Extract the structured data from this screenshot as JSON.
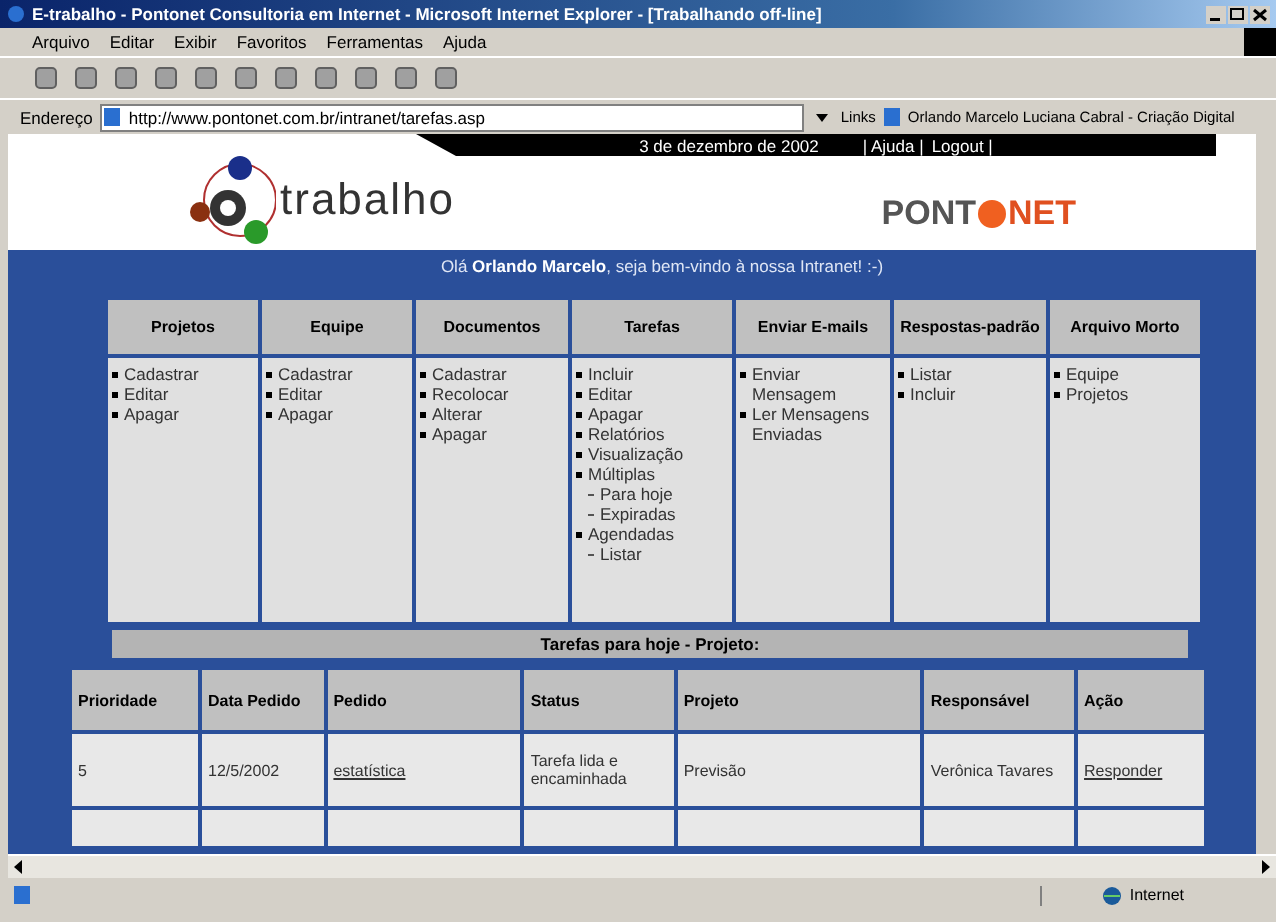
{
  "window": {
    "title": "E-trabalho - Pontonet Consultoria em Internet - Microsoft Internet Explorer - [Trabalhando off-line]"
  },
  "menu_bar": [
    "Arquivo",
    "Editar",
    "Exibir",
    "Favoritos",
    "Ferramentas",
    "Ajuda"
  ],
  "address_bar": {
    "label": "Endereço",
    "value": "http://www.pontonet.com.br/intranet/tarefas.asp",
    "links_label": "Links",
    "link": "Orlando Marcelo Luciana Cabral - Criação Digital"
  },
  "header": {
    "date": "3 de dezembro de 2002",
    "links": [
      "| Ajuda |",
      "Logout |"
    ],
    "logo": "trabalho",
    "partner_logo_left": "PONT",
    "partner_logo_right": "NET",
    "greeting": "Olá **Orlando Marcelo**, seja bem-vindo à nossa Intranet! :-)"
  },
  "menu_columns": [
    {
      "title": "Projetos",
      "items": [
        {
          "label": "Cadastrar"
        },
        {
          "label": "Editar"
        },
        {
          "label": "Apagar"
        }
      ]
    },
    {
      "title": "Equipe",
      "items": [
        {
          "label": "Cadastrar"
        },
        {
          "label": "Editar"
        },
        {
          "label": "Apagar"
        }
      ]
    },
    {
      "title": "Documentos",
      "items": [
        {
          "label": "Cadastrar"
        },
        {
          "label": "Recolocar"
        },
        {
          "label": "Alterar"
        },
        {
          "label": "Apagar"
        }
      ]
    },
    {
      "title": "Tarefas",
      "items": [
        {
          "label": "Incluir"
        },
        {
          "label": "Editar"
        },
        {
          "label": "Apagar"
        },
        {
          "label": "Relatórios"
        },
        {
          "label": "Visualização"
        },
        {
          "label": "Múltiplas",
          "children": [
            {
              "label": "Para hoje"
            },
            {
              "label": "Expiradas"
            }
          ]
        },
        {
          "label": "Agendadas",
          "children": [
            {
              "label": "Listar"
            }
          ]
        }
      ]
    },
    {
      "title": "Enviar E-mails",
      "items": [
        {
          "label": "Enviar Mensagem"
        },
        {
          "label": "Ler Mensagens Enviadas"
        }
      ]
    },
    {
      "title": "Respostas-padrão",
      "items": [
        {
          "label": "Listar"
        },
        {
          "label": "Incluir"
        }
      ]
    },
    {
      "title": "Arquivo Morto",
      "items": [
        {
          "label": "Equipe"
        },
        {
          "label": "Projetos"
        }
      ]
    }
  ],
  "tasks": {
    "title": "Tarefas para hoje - Projeto:",
    "columns": [
      "Prioridade",
      "Data Pedido",
      "Pedido",
      "Status",
      "Projeto",
      "Responsável",
      "Ação"
    ],
    "rows": [
      [
        "5",
        "12/5/2002",
        "estatística",
        "Tarefa lida e encaminhada",
        "Previsão",
        "Verônica Tavares",
        "Responder"
      ]
    ]
  },
  "status_bar": {
    "zone": "Internet"
  }
}
